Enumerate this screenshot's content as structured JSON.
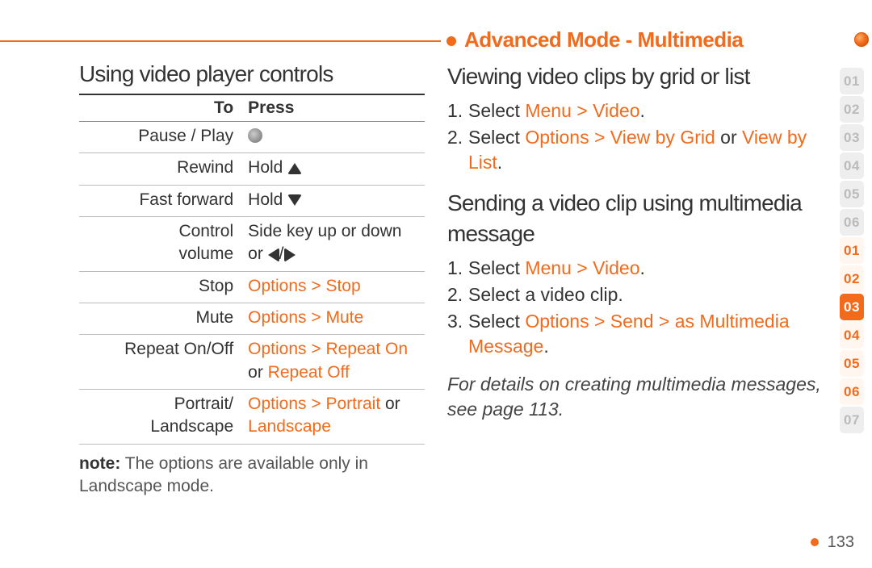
{
  "header": {
    "title": "Advanced Mode - Multimedia"
  },
  "left": {
    "heading": "Using video player controls",
    "th_to": "To",
    "th_press": "Press",
    "rows": {
      "r1_to": "Pause / Play",
      "r2_to": "Rewind",
      "r2_press_pre": "Hold ",
      "r3_to": "Fast forward",
      "r3_press_pre": "Hold ",
      "r4_to_l1": "Control",
      "r4_to_l2": "volume",
      "r4_press_l1": "Side key up or down",
      "r4_press_l2_pre": "or ",
      "r5_to": "Stop",
      "r5_press": "Options > Stop",
      "r6_to": "Mute",
      "r6_press": "Options > Mute",
      "r7_to": "Repeat On/Off",
      "r7_press_l1": "Options > Repeat On",
      "r7_press_l2_pre": "or ",
      "r7_press_l2": "Repeat Off",
      "r8_to_l1": "Portrait/",
      "r8_to_l2": "Landscape",
      "r8_press_l1a": "Options > Portrait",
      "r8_press_l1b": " or",
      "r8_press_l2": "Landscape"
    },
    "note_label": "note:",
    "note_text": " The options are available only in Landscape mode."
  },
  "right": {
    "h1": "Viewing video clips by grid or list",
    "s1_1a": "1.",
    "s1_1b": "Select ",
    "s1_1c": "Menu > Video",
    "s1_1d": ".",
    "s1_2a": "2.",
    "s1_2b": "Select ",
    "s1_2c": "Options > View by Grid",
    "s1_2d": " or ",
    "s1_2e": "View by List",
    "s1_2f": ".",
    "h2": "Sending a video clip using multimedia message",
    "s2_1a": "1.",
    "s2_1b": "Select ",
    "s2_1c": "Menu > Video",
    "s2_1d": ".",
    "s2_2a": "2.",
    "s2_2b": "Select a video clip.",
    "s2_3a": "3.",
    "s2_3b": "Select ",
    "s2_3c": "Options > Send > as Multimedia Message",
    "s2_3d": ".",
    "note": "For details on creating multimedia messages, see page 113."
  },
  "tabs": [
    "01",
    "02",
    "03",
    "04",
    "05",
    "06",
    "01",
    "02",
    "03",
    "04",
    "05",
    "06",
    "07"
  ],
  "page_number": "133"
}
